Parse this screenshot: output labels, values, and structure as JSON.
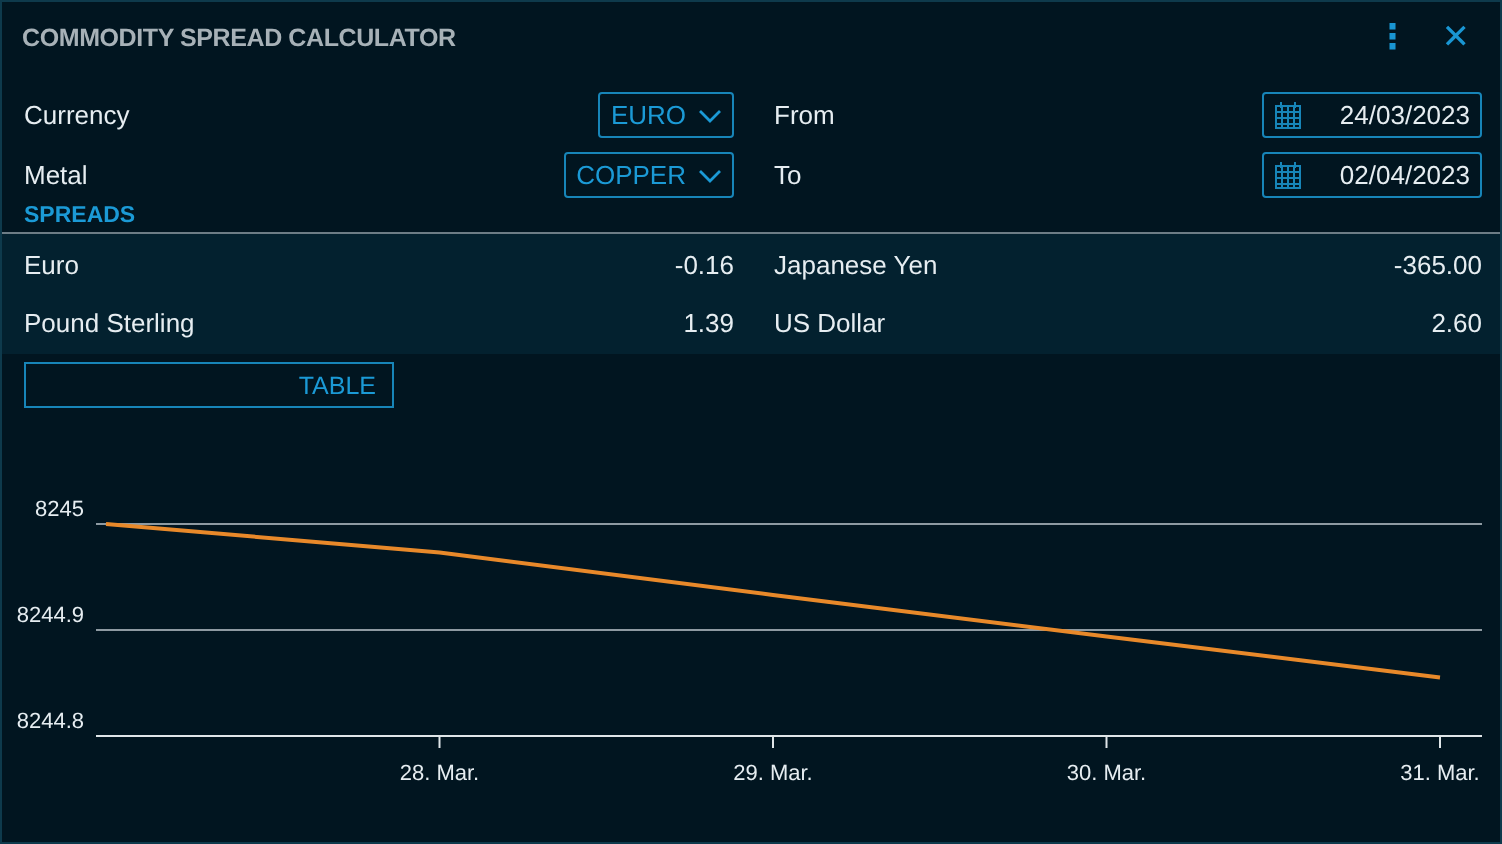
{
  "window": {
    "title": "COMMODITY SPREAD CALCULATOR",
    "icons": [
      "⋮",
      "✕"
    ]
  },
  "filters": [
    {
      "label": "Currency",
      "value": "EURO",
      "kind": "dropdown"
    },
    {
      "label": "From",
      "value": "24/03/2023",
      "kind": "date"
    },
    {
      "label": "Metal",
      "value": "COPPER",
      "kind": "dropdown"
    },
    {
      "label": "To",
      "value": "02/04/2023",
      "kind": "date"
    }
  ],
  "spreads": {
    "title": "SPREADS",
    "items": [
      {
        "name": "Euro",
        "value": "-0.16"
      },
      {
        "name": "Japanese Yen",
        "value": "-365.00"
      },
      {
        "name": "Pound Sterling",
        "value": "1.39"
      },
      {
        "name": "US Dollar",
        "value": "2.60"
      }
    ]
  },
  "view_button": "TABLE",
  "chart": {
    "chart_data": {
      "type": "line",
      "categories": [
        null,
        "28. Mar.",
        "29. Mar.",
        "30. Mar.",
        "31. Mar."
      ],
      "series": [
        {
          "color": "#e8892a",
          "values": [
            8245,
            8244.973,
            8244.933,
            8244.894,
            8244.855
          ]
        }
      ],
      "ylim": [
        8244.8,
        8245
      ],
      "yticks": [
        8244.8,
        8244.9,
        8245
      ]
    }
  }
}
